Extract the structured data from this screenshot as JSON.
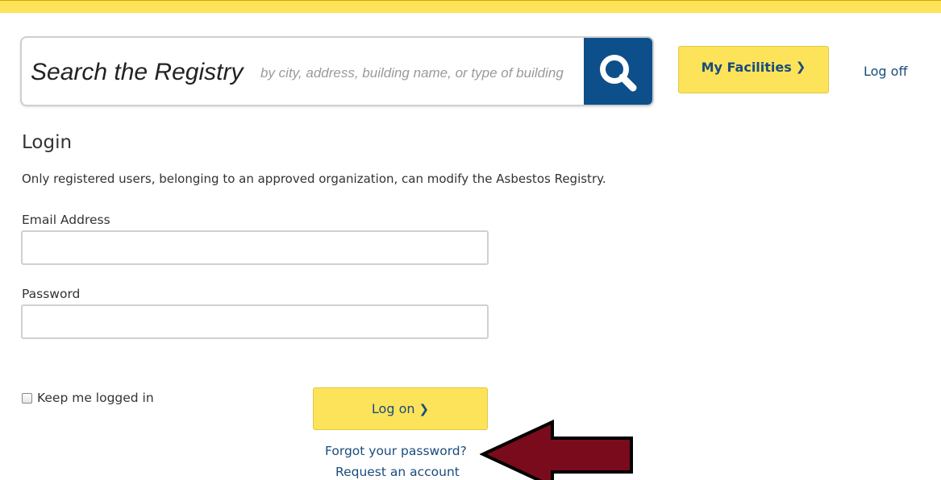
{
  "header": {
    "search_title": "Search the Registry",
    "search_placeholder": "by city, address, building name, or type of building",
    "search_icon": "magnifying-glass-icon",
    "my_facilities_label": "My Facilities",
    "my_facilities_icon": "chevron-right-icon",
    "log_off_label": "Log off"
  },
  "login": {
    "heading": "Login",
    "intro": "Only registered users, belonging to an approved organization, can modify the Asbestos Registry.",
    "email_label": "Email Address",
    "email_value": "",
    "password_label": "Password",
    "password_value": "",
    "keep_logged_in_label": "Keep me logged in",
    "keep_logged_in_checked": false,
    "logon_label": "Log on",
    "logon_icon": "chevron-right-icon",
    "forgot_password_label": "Forgot your password?",
    "request_account_label": "Request an account"
  },
  "annotation": {
    "arrow_icon": "left-arrow-icon"
  },
  "colors": {
    "accent_yellow": "#fde35a",
    "brand_blue": "#0d4f8a",
    "link_blue": "#1a4c7c",
    "arrow_fill": "#7a0b1c"
  }
}
